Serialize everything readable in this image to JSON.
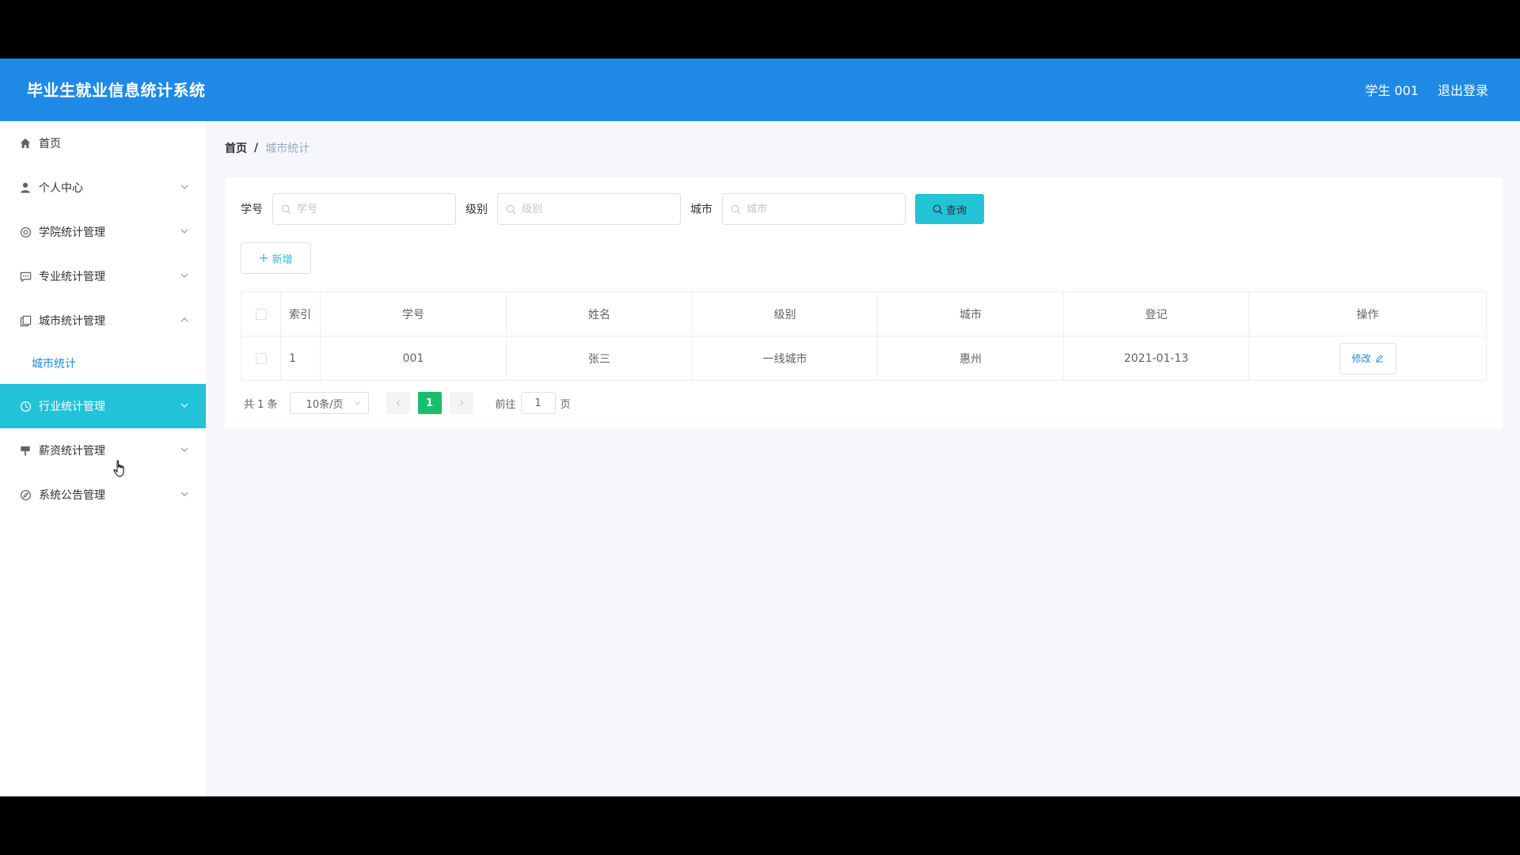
{
  "header": {
    "title": "毕业生就业信息统计系统",
    "user": "学生 001",
    "logout": "退出登录"
  },
  "sidebar": {
    "items": [
      {
        "label": "首页",
        "icon": "home-icon"
      },
      {
        "label": "个人中心",
        "icon": "user-icon"
      },
      {
        "label": "学院统计管理",
        "icon": "settings-icon"
      },
      {
        "label": "专业统计管理",
        "icon": "chat-icon"
      },
      {
        "label": "城市统计管理",
        "icon": "copy-icon",
        "expanded": true
      },
      {
        "label": "行业统计管理",
        "icon": "clock-icon",
        "active": true
      },
      {
        "label": "薪资统计管理",
        "icon": "sign-icon"
      },
      {
        "label": "系统公告管理",
        "icon": "compass-icon"
      }
    ],
    "sub_item": "城市统计"
  },
  "breadcrumb": {
    "home": "首页",
    "separator": "/",
    "current": "城市统计"
  },
  "filters": {
    "student_id": {
      "label": "学号",
      "placeholder": "学号"
    },
    "level": {
      "label": "级别",
      "placeholder": "级别"
    },
    "city": {
      "label": "城市",
      "placeholder": "城市"
    },
    "query_label": "查询"
  },
  "add_label": "新增",
  "table": {
    "headers": [
      "索引",
      "学号",
      "姓名",
      "级别",
      "城市",
      "登记",
      "操作"
    ],
    "rows": [
      {
        "index": "1",
        "student_id": "001",
        "name": "张三",
        "level": "一线城市",
        "city": "惠州",
        "date": "2021-01-13",
        "action": "修改"
      }
    ]
  },
  "pagination": {
    "total": "共 1 条",
    "page_size": "10条/页",
    "current_page": "1",
    "goto_label": "前往",
    "goto_value": "1",
    "page_suffix": "页"
  },
  "colors": {
    "header": "#1e8ae6",
    "accent": "#22c2d8",
    "active_page": "#19be6b"
  }
}
